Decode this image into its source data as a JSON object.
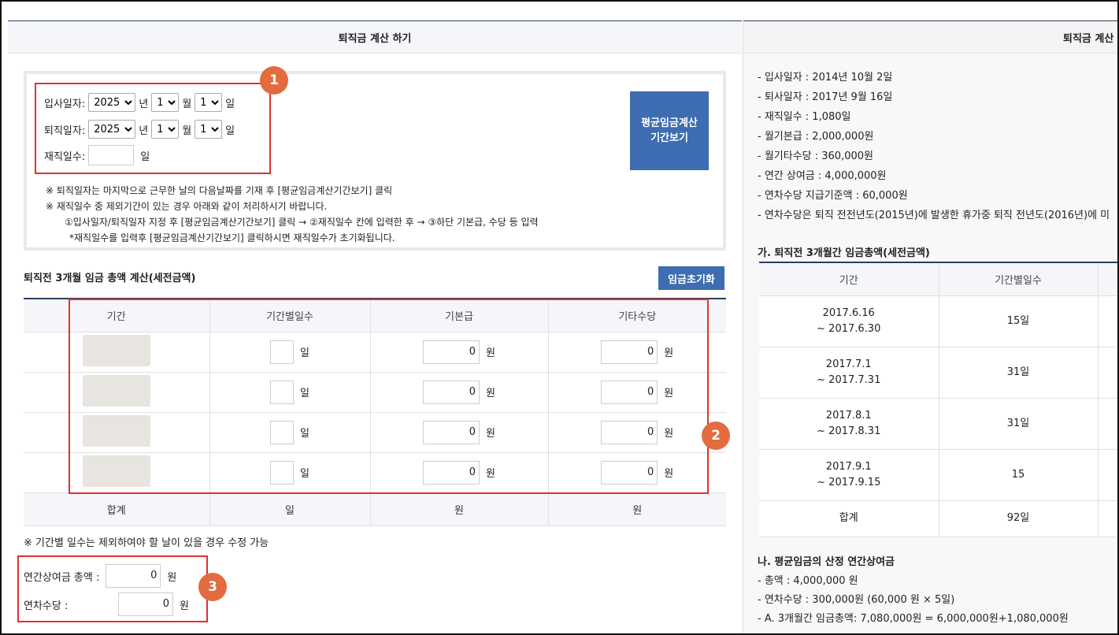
{
  "left_panel": {
    "title": "퇴직금 계산 하기",
    "hire_date": {
      "label": "입사일자:",
      "year": "2025",
      "year_unit": "년",
      "month": "1",
      "month_unit": "월",
      "day": "1",
      "day_unit": "일"
    },
    "retire_date": {
      "label": "퇴직일자:",
      "year": "2025",
      "year_unit": "년",
      "month": "1",
      "month_unit": "월",
      "day": "1",
      "day_unit": "일"
    },
    "service_days": {
      "label": "재직일수:",
      "value": "",
      "unit": "일"
    },
    "avg_wage_button": {
      "line1": "평균임금계산",
      "line2": "기간보기"
    },
    "notes": [
      "※ 퇴직일자는 마지막으로 근무한 날의 다음날짜를 기재 후 [평균임금계산기간보기] 클릭",
      "※ 재직일수 중 제외기간이 있는 경우 아래와 같이 처리하시기 바랍니다.",
      "①입사일자/퇴직일자 지정 후 [평균임금계산기간보기] 클릭 → ②재직일수 칸에 입력한 후 → ③하단 기본급, 수당 등 입력",
      "*재직일수를 입력후 [평균임금계산기간보기] 클릭하시면 재직일수가 초기화됩니다."
    ],
    "section_title": "퇴직전 3개월 임금 총액 계산(세전금액)",
    "reset_button": "임금초기화",
    "table": {
      "headers": [
        "기간",
        "기간별일수",
        "기본급",
        "기타수당"
      ],
      "rows": [
        {
          "days": "",
          "days_unit": "일",
          "base": "0",
          "base_unit": "원",
          "other": "0",
          "other_unit": "원"
        },
        {
          "days": "",
          "days_unit": "일",
          "base": "0",
          "base_unit": "원",
          "other": "0",
          "other_unit": "원"
        },
        {
          "days": "",
          "days_unit": "일",
          "base": "0",
          "base_unit": "원",
          "other": "0",
          "other_unit": "원"
        },
        {
          "days": "",
          "days_unit": "일",
          "base": "0",
          "base_unit": "원",
          "other": "0",
          "other_unit": "원"
        }
      ],
      "total": {
        "label": "합계",
        "days": "일",
        "base": "원",
        "other": "원"
      }
    },
    "note2": "※ 기간별 일수는 제외하여야 할 날이 있을 경우 수정 가능",
    "annual_bonus": {
      "label": "연간상여금 총액 :",
      "value": "0",
      "unit": "원"
    },
    "annual_leave": {
      "label": "연차수당 :",
      "value": "0",
      "unit": "원"
    },
    "badges": [
      "1",
      "2",
      "3"
    ]
  },
  "right_panel": {
    "title": "퇴직금 계산",
    "info": [
      "- 입사일자 : 2014년 10월 2일",
      "- 퇴사일자 : 2017년 9월 16일",
      "- 재직일수 : 1,080일",
      "- 월기본급 : 2,000,000원",
      "- 월기타수당 : 360,000원",
      "- 연간 상여금 : 4,000,000원",
      "- 연차수당 지급기준액 : 60,000원",
      "- 연차수당은 퇴직 전전년도(2015년)에 발생한 휴가중 퇴직 전년도(2016년)에 미"
    ],
    "section_a": "가. 퇴직전 3개월간 임금총액(세전금액)",
    "table": {
      "headers": [
        "기간",
        "기간별일수"
      ],
      "rows": [
        {
          "period1": "2017.6.16",
          "period2": "~ 2017.6.30",
          "days": "15일"
        },
        {
          "period1": "2017.7.1",
          "period2": "~ 2017.7.31",
          "days": "31일"
        },
        {
          "period1": "2017.8.1",
          "period2": "~ 2017.8.31",
          "days": "31일"
        },
        {
          "period1": "2017.9.1",
          "period2": "~ 2017.9.15",
          "days": "15"
        }
      ],
      "total": {
        "label": "합계",
        "days": "92일"
      }
    },
    "section_b": "나. 평균임금의 산정 연간상여금",
    "info2": [
      "- 총액 : 4,000,000 원",
      "- 연차수당 : 300,000원 (60,000 원 × 5일)",
      "- A. 3개월간 임금총액: 7,080,000원 = 6,000,000원+1,080,000원"
    ]
  },
  "colors": {
    "accent": "#3e6db1",
    "badge": "#e36b3f",
    "highlight": "#e03131",
    "navy": "#2d3e5c"
  }
}
